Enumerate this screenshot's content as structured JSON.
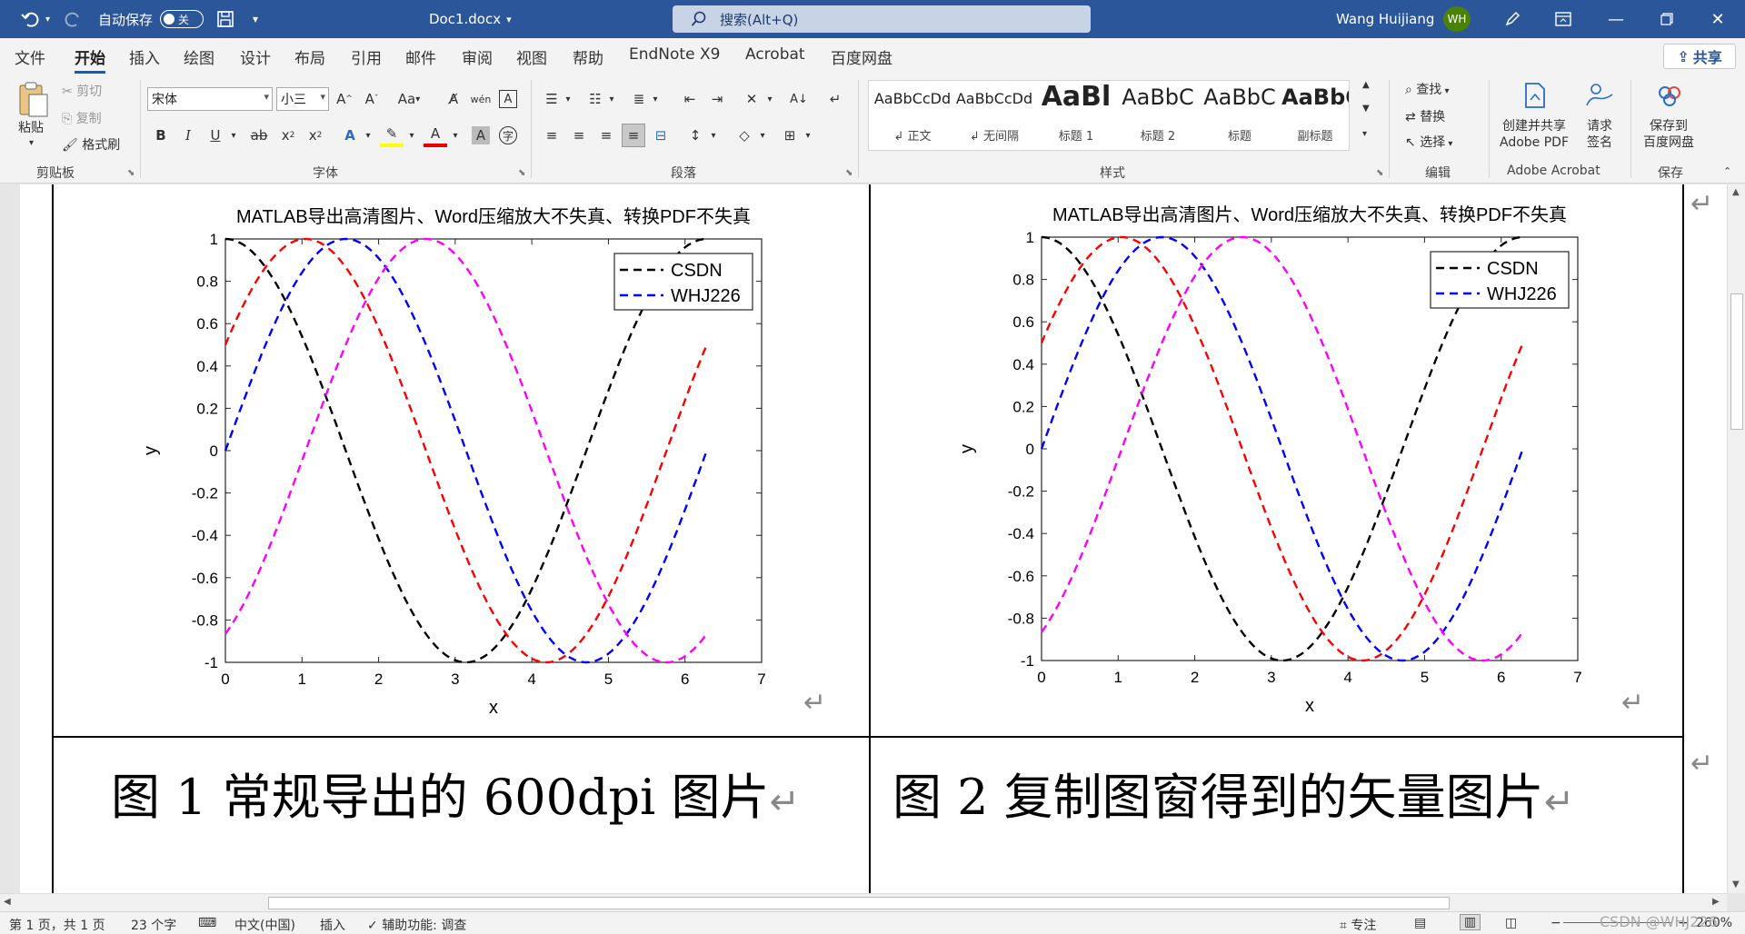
{
  "titlebar": {
    "autosave_label": "自动保存",
    "autosave_state": "关",
    "doc_name": "Doc1.docx",
    "search_placeholder": "搜索(Alt+Q)",
    "user_name": "Wang Huijiang",
    "user_initials": "WH",
    "bg_color": "#2b579a"
  },
  "tabs": [
    "文件",
    "开始",
    "插入",
    "绘图",
    "设计",
    "布局",
    "引用",
    "邮件",
    "审阅",
    "视图",
    "帮助",
    "EndNote X9",
    "Acrobat",
    "百度网盘"
  ],
  "active_tab": "开始",
  "share_label": "共享",
  "ribbon": {
    "clipboard": {
      "paste": "粘贴",
      "cut": "剪切",
      "copy": "复制",
      "format_painter": "格式刷",
      "label": "剪贴板"
    },
    "font": {
      "font_name": "宋体",
      "font_size": "小三",
      "label": "字体",
      "change_case": "Aa"
    },
    "paragraph": {
      "label": "段落"
    },
    "styles": {
      "label": "样式",
      "items": [
        {
          "preview": "AaBbCcDd",
          "name": "↲ 正文"
        },
        {
          "preview": "AaBbCcDd",
          "name": "↲ 无间隔"
        },
        {
          "preview": "AaBl",
          "name": "标题 1"
        },
        {
          "preview": "AaBbC",
          "name": "标题 2"
        },
        {
          "preview": "AaBbC",
          "name": "标题"
        },
        {
          "preview": "AaBbC",
          "name": "副标题"
        }
      ]
    },
    "editing": {
      "label": "编辑",
      "find": "查找",
      "replace": "替换",
      "select": "选择"
    },
    "acrobat": {
      "label": "Adobe Acrobat",
      "create_pdf": "创建并共享\nAdobe PDF",
      "sign": "请求\n签名"
    },
    "save": {
      "label": "保存",
      "baidu": "保存到\n百度网盘"
    }
  },
  "document": {
    "caption_left": "图 1  常规导出的 600dpi 图片",
    "caption_right": "图 2  复制图窗得到的矢量图片"
  },
  "chart_data": [
    {
      "type": "line",
      "title": "MATLAB导出高清图片、Word压缩放大不失真、转换PDF不失真",
      "xlabel": "x",
      "ylabel": "y",
      "xlim": [
        0,
        7
      ],
      "ylim": [
        -1,
        1
      ],
      "xticks": [
        "0",
        "1",
        "2",
        "3",
        "4",
        "5",
        "6",
        "7"
      ],
      "yticks": [
        "-1",
        "-0.8",
        "-0.6",
        "-0.4",
        "-0.2",
        "0",
        "0.2",
        "0.4",
        "0.6",
        "0.8",
        "1"
      ],
      "legend": [
        "CSDN",
        "WHJ226"
      ],
      "legend_position": "top-right",
      "grid": false,
      "line_style": "dashed",
      "series": [
        {
          "name": "CSDN",
          "function": "cos(x)",
          "color": "#000000"
        },
        {
          "name": "WHJ226",
          "function": "sin(x)",
          "color": "#0000ff"
        },
        {
          "function": "sin(x+0.5236)",
          "color": "#ff0000"
        },
        {
          "function": "sin(x-1.0472)",
          "color": "#ff00ff"
        }
      ],
      "x_range": [
        0,
        6.2832
      ]
    },
    {
      "type": "line",
      "title": "MATLAB导出高清图片、Word压缩放大不失真、转换PDF不失真",
      "xlabel": "x",
      "ylabel": "y",
      "xlim": [
        0,
        7
      ],
      "ylim": [
        -1,
        1
      ],
      "xticks": [
        "0",
        "1",
        "2",
        "3",
        "4",
        "5",
        "6",
        "7"
      ],
      "yticks": [
        "-1",
        "-0.8",
        "-0.6",
        "-0.4",
        "-0.2",
        "0",
        "0.2",
        "0.4",
        "0.6",
        "0.8",
        "1"
      ],
      "legend": [
        "CSDN",
        "WHJ226"
      ],
      "legend_position": "top-right",
      "grid": false,
      "line_style": "dashed",
      "series": [
        {
          "name": "CSDN",
          "function": "cos(x)",
          "color": "#000000"
        },
        {
          "name": "WHJ226",
          "function": "sin(x)",
          "color": "#0000ff"
        },
        {
          "function": "sin(x+0.5236)",
          "color": "#ff0000"
        },
        {
          "function": "sin(x-1.0472)",
          "color": "#ff00ff"
        }
      ],
      "x_range": [
        0,
        6.2832
      ]
    }
  ],
  "status": {
    "page": "第 1 页，共 1 页",
    "words": "23 个字",
    "language": "中文(中国)",
    "mode": "插入",
    "accessibility": "辅助功能: 调查",
    "focus": "专注",
    "zoom": "260%",
    "watermark": "CSDN @WHJ226"
  }
}
